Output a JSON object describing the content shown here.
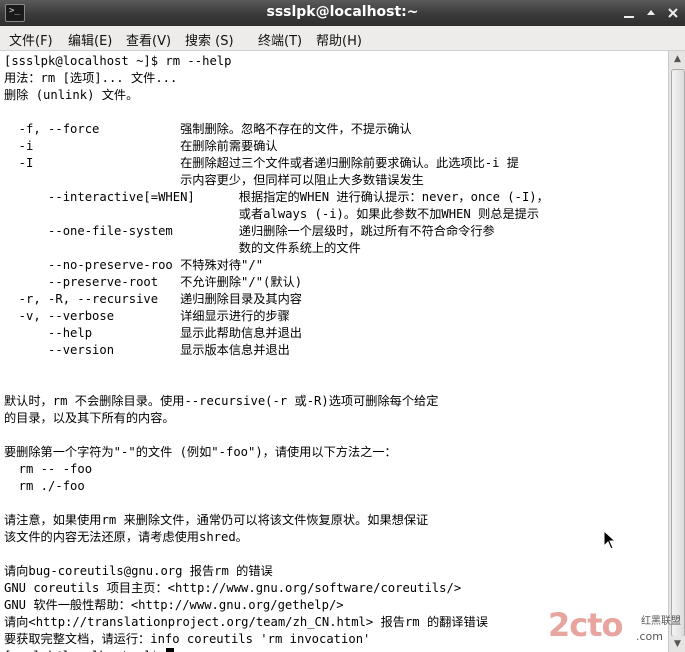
{
  "window": {
    "title": "ssslpk@localhost:~",
    "icon_text": ">_",
    "minimize_icon": "minimize-icon",
    "maximize_icon": "maximize-icon",
    "close_icon": "close-icon"
  },
  "menubar": {
    "items": [
      "文件(F)",
      "编辑(E)",
      "查看(V)",
      "搜索 (S)",
      "终端(T)",
      "帮助(H)"
    ]
  },
  "terminal": {
    "lines": [
      "[ssslpk@localhost ~]$ rm --help",
      "用法：rm [选项]... 文件...",
      "删除 (unlink) 文件。",
      "",
      "  -f, --force           强制删除。忽略不存在的文件，不提示确认",
      "  -i                    在删除前需要确认",
      "  -I                    在删除超过三个文件或者递归删除前要求确认。此选项比-i 提",
      "                        示内容更少，但同样可以阻止大多数错误发生",
      "      --interactive[=WHEN]      根据指定的WHEN 进行确认提示：never，once (-I)，",
      "                                或者always (-i)。如果此参数不加WHEN 则总是提示",
      "      --one-file-system         递归删除一个层级时，跳过所有不符合命令行参",
      "                                数的文件系统上的文件",
      "      --no-preserve-roo 不特殊对待\"/\"",
      "      --preserve-root   不允许删除\"/\"(默认)",
      "  -r, -R, --recursive   递归删除目录及其内容",
      "  -v, --verbose         详细显示进行的步骤",
      "      --help            显示此帮助信息并退出",
      "      --version         显示版本信息并退出",
      "",
      "",
      "默认时，rm 不会删除目录。使用--recursive(-r 或-R)选项可删除每个给定",
      "的目录，以及其下所有的内容。",
      "",
      "要删除第一个字符为\"-\"的文件 (例如\"-foo\")，请使用以下方法之一：",
      "  rm -- -foo",
      "  rm ./-foo",
      "",
      "请注意，如果使用rm 来删除文件，通常仍可以将该文件恢复原状。如果想保证",
      "该文件的内容无法还原，请考虑使用shred。",
      "",
      "请向bug-coreutils@gnu.org 报告rm 的错误",
      "GNU coreutils 项目主页：<http://www.gnu.org/software/coreutils/>",
      "GNU 软件一般性帮助：<http://www.gnu.org/gethelp/>",
      "请向<http://translationproject.org/team/zh_CN.html> 报告rm 的翻译错误",
      "要获取完整文档，请运行：info coreutils 'rm invocation'",
      "[ssslpk@localhost ~]$ "
    ]
  },
  "watermark": {
    "main": "2cto",
    "top": "红黑联盟",
    "bottom": ".com"
  }
}
